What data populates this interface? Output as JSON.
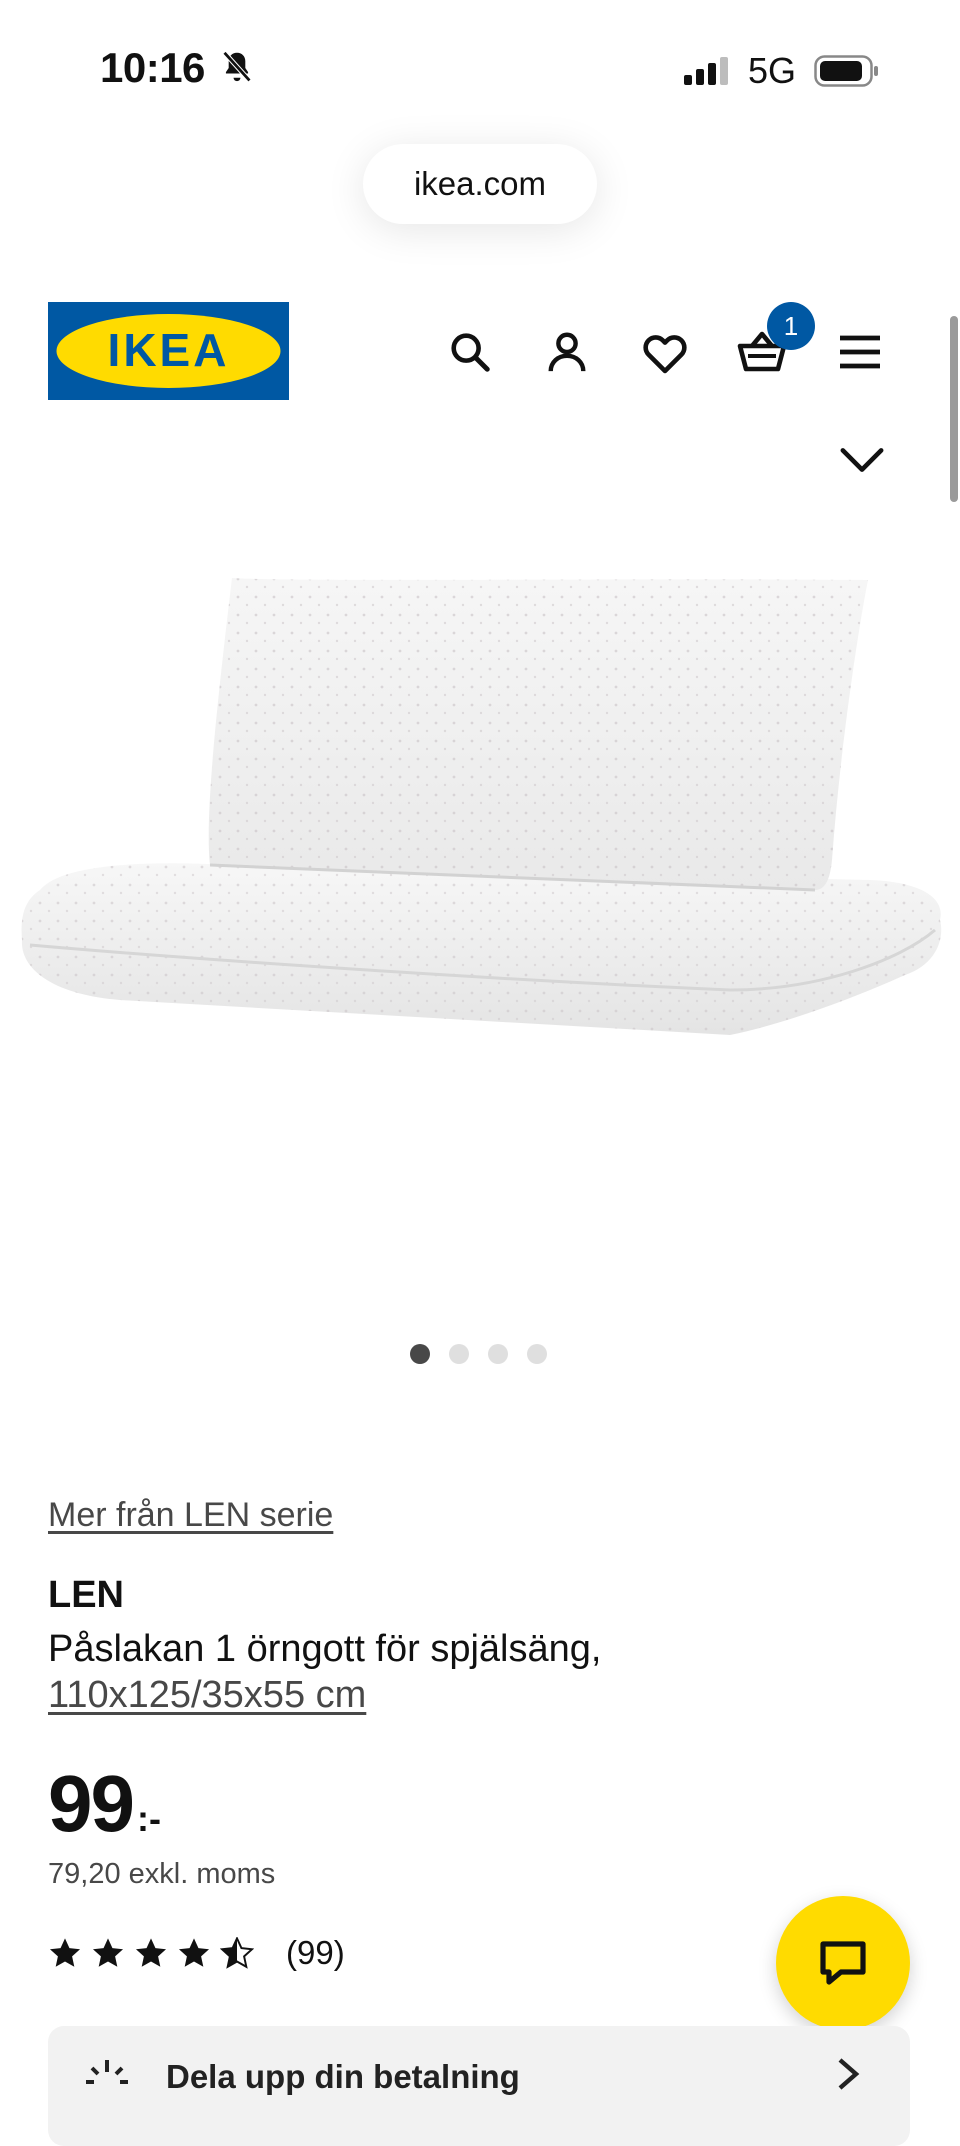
{
  "status_bar": {
    "time": "10:16",
    "network": "5G",
    "icons": [
      "bell-muted-icon",
      "cellular-signal-icon",
      "battery-icon"
    ]
  },
  "browser": {
    "url": "ikea.com"
  },
  "header": {
    "logo_text": "IKEA",
    "icons": [
      "search-icon",
      "account-icon",
      "heart-icon",
      "cart-icon",
      "menu-icon",
      "chevron-down-icon"
    ],
    "cart_count": "1"
  },
  "product": {
    "series_link": "Mer från LEN serie",
    "name": "LEN",
    "description": "Påslakan 1 örngott för spjälsäng,",
    "size": "110x125/35x55 cm",
    "price_integer": "99",
    "price_suffix": ":-",
    "price_excl_vat": "79,20 exkl. moms",
    "rating_value": 4.5,
    "rating_max": 5,
    "review_count": "(99)"
  },
  "carousel": {
    "total_images": 4,
    "active_index": 0
  },
  "payment_banner": {
    "label": "Dela upp din betalning"
  },
  "colors": {
    "ikea_blue": "#0058a3",
    "ikea_yellow": "#ffdb00",
    "text": "#111111",
    "muted_text": "#484848"
  }
}
